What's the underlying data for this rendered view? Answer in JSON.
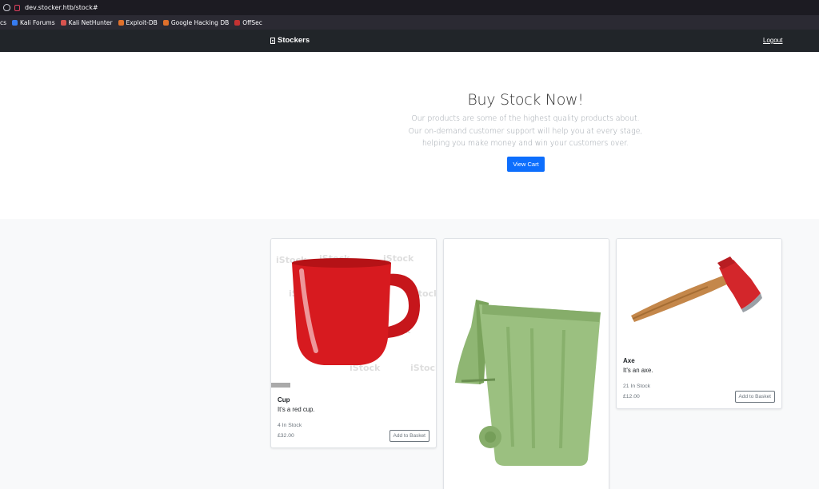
{
  "browser": {
    "url": "dev.stocker.htb/stock#",
    "bookmarks": [
      "cs",
      "Kali Forums",
      "Kali NetHunter",
      "Exploit-DB",
      "Google Hacking DB",
      "OffSec"
    ]
  },
  "navbar": {
    "brand": "Stockers",
    "logout": "Logout"
  },
  "hero": {
    "title": "Buy Stock Now!",
    "text": "Our products are some of the highest quality products about. Our on-demand customer support will help you at every stage, helping you make money and win your customers over.",
    "button": "View Cart"
  },
  "products": [
    {
      "title": "Cup",
      "desc": "It's a red cup.",
      "stock": "4 In Stock",
      "price": "£32.00",
      "button": "Add to Basket"
    },
    {
      "title": "Bin",
      "desc": "",
      "stock": "",
      "price": "",
      "button": ""
    },
    {
      "title": "Axe",
      "desc": "It's an axe.",
      "stock": "21 In Stock",
      "price": "£12.00",
      "button": "Add to Basket"
    }
  ],
  "watermark": "iStock",
  "colors": {
    "primary": "#0d6efd",
    "navbar": "#212529"
  }
}
